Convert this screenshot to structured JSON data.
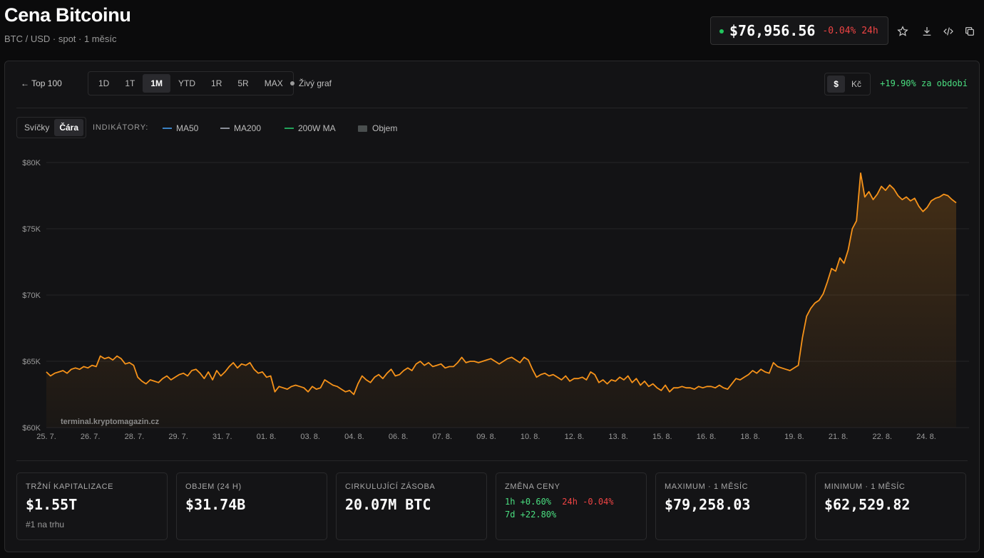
{
  "header": {
    "title": "Cena Bitcoinu",
    "subtitle": "BTC / USD · spot · 1 měsíc",
    "price": "$76,956.56",
    "change_24h": "-0.04% 24h"
  },
  "toolbar": {
    "back_label": "← Top 100",
    "timeframes": [
      "1D",
      "1T",
      "1M",
      "YTD",
      "1R",
      "5R",
      "MAX"
    ],
    "active_timeframe": "1M",
    "live_label": "Živý graf",
    "currencies": [
      "$",
      "Kč"
    ],
    "active_currency": "$",
    "period_change": "+19.90% za období"
  },
  "indicators": {
    "types": [
      "Svíčky",
      "Čára"
    ],
    "active_type": "Čára",
    "label": "INDIKÁTORY:",
    "items": [
      {
        "label": "MA50",
        "color": "#3b82c4"
      },
      {
        "label": "MA200",
        "color": "#8a8f99"
      },
      {
        "label": "200W MA",
        "color": "#22a35a"
      },
      {
        "label": "Objem",
        "color": "#4a4f4f"
      }
    ]
  },
  "chart_data": {
    "type": "line",
    "watermark": "terminal.kryptomagazin.cz",
    "y_ticks": [
      "$80K",
      "$75K",
      "$70K",
      "$65K",
      "$60K"
    ],
    "ylim": [
      60000,
      80000
    ],
    "x_ticks": [
      "25. 7.",
      "26. 7.",
      "28. 7.",
      "29. 7.",
      "31. 7.",
      "01. 8.",
      "03. 8.",
      "04. 8.",
      "06. 8.",
      "07. 8.",
      "09. 8.",
      "10. 8.",
      "12. 8.",
      "13. 8.",
      "15. 8.",
      "16. 8.",
      "18. 8.",
      "19. 8.",
      "21. 8.",
      "22. 8.",
      "24. 8."
    ],
    "line_color": "#f7931a",
    "values": [
      64200,
      63900,
      64100,
      64200,
      64300,
      64100,
      64400,
      64500,
      64400,
      64600,
      64500,
      64700,
      64600,
      65400,
      65200,
      65300,
      65100,
      65400,
      65200,
      64800,
      64900,
      64700,
      63800,
      63500,
      63300,
      63600,
      63500,
      63400,
      63700,
      63900,
      63600,
      63800,
      64000,
      64100,
      63900,
      64300,
      64400,
      64100,
      63700,
      64200,
      63600,
      64300,
      63900,
      64200,
      64600,
      64900,
      64500,
      64800,
      64700,
      64900,
      64400,
      64100,
      64200,
      63800,
      63900,
      62700,
      63100,
      63000,
      62900,
      63100,
      63200,
      63100,
      63000,
      62700,
      63100,
      62900,
      63000,
      63600,
      63400,
      63200,
      63100,
      62900,
      62700,
      62800,
      62500,
      63300,
      63900,
      63600,
      63400,
      63800,
      64000,
      63700,
      64100,
      64400,
      63900,
      64000,
      64300,
      64500,
      64300,
      64800,
      65000,
      64700,
      64900,
      64600,
      64700,
      64800,
      64500,
      64600,
      64600,
      64900,
      65300,
      64900,
      65000,
      65000,
      64900,
      65000,
      65100,
      65200,
      65000,
      64800,
      65000,
      65200,
      65300,
      65100,
      64900,
      65300,
      65100,
      64400,
      63800,
      64000,
      64100,
      63900,
      64000,
      63800,
      63600,
      63900,
      63500,
      63700,
      63700,
      63800,
      63600,
      64200,
      64000,
      63400,
      63600,
      63300,
      63600,
      63500,
      63800,
      63600,
      63900,
      63400,
      63700,
      63200,
      63500,
      63100,
      63300,
      63000,
      62800,
      63200,
      62700,
      63000,
      63000,
      63100,
      63000,
      63000,
      62900,
      63100,
      63000,
      63100,
      63100,
      63000,
      63200,
      63000,
      62900,
      63300,
      63700,
      63600,
      63800,
      64000,
      64300,
      64100,
      64400,
      64200,
      64100,
      64900,
      64600,
      64500,
      64400,
      64300,
      64500,
      64700,
      66800,
      68400,
      69000,
      69400,
      69600,
      70100,
      71000,
      72000,
      71800,
      72800,
      72400,
      73400,
      75000,
      75600,
      79200,
      77400,
      77800,
      77200,
      77600,
      78200,
      77900,
      78300,
      78000,
      77500,
      77200,
      77400,
      77100,
      77300,
      76700,
      76300,
      76600,
      77100,
      77300,
      77400,
      77600,
      77500,
      77200,
      76956
    ]
  },
  "stats": [
    {
      "label": "TRŽNÍ KAPITALIZACE",
      "value": "$1.55T",
      "sub": "#1 na trhu"
    },
    {
      "label": "OBJEM (24 H)",
      "value": "$31.74B"
    },
    {
      "label": "CIRKULUJÍCÍ ZÁSOBA",
      "value": "20.07M BTC"
    },
    {
      "label": "ZMĚNA CENY",
      "changes": {
        "h1": "1h +0.60%",
        "h24": "24h -0.04%",
        "d7": "7d +22.80%"
      }
    },
    {
      "label": "MAXIMUM · 1 MĚSÍC",
      "value": "$79,258.03"
    },
    {
      "label": "MINIMUM · 1 MĚSÍC",
      "value": "$62,529.82"
    }
  ]
}
